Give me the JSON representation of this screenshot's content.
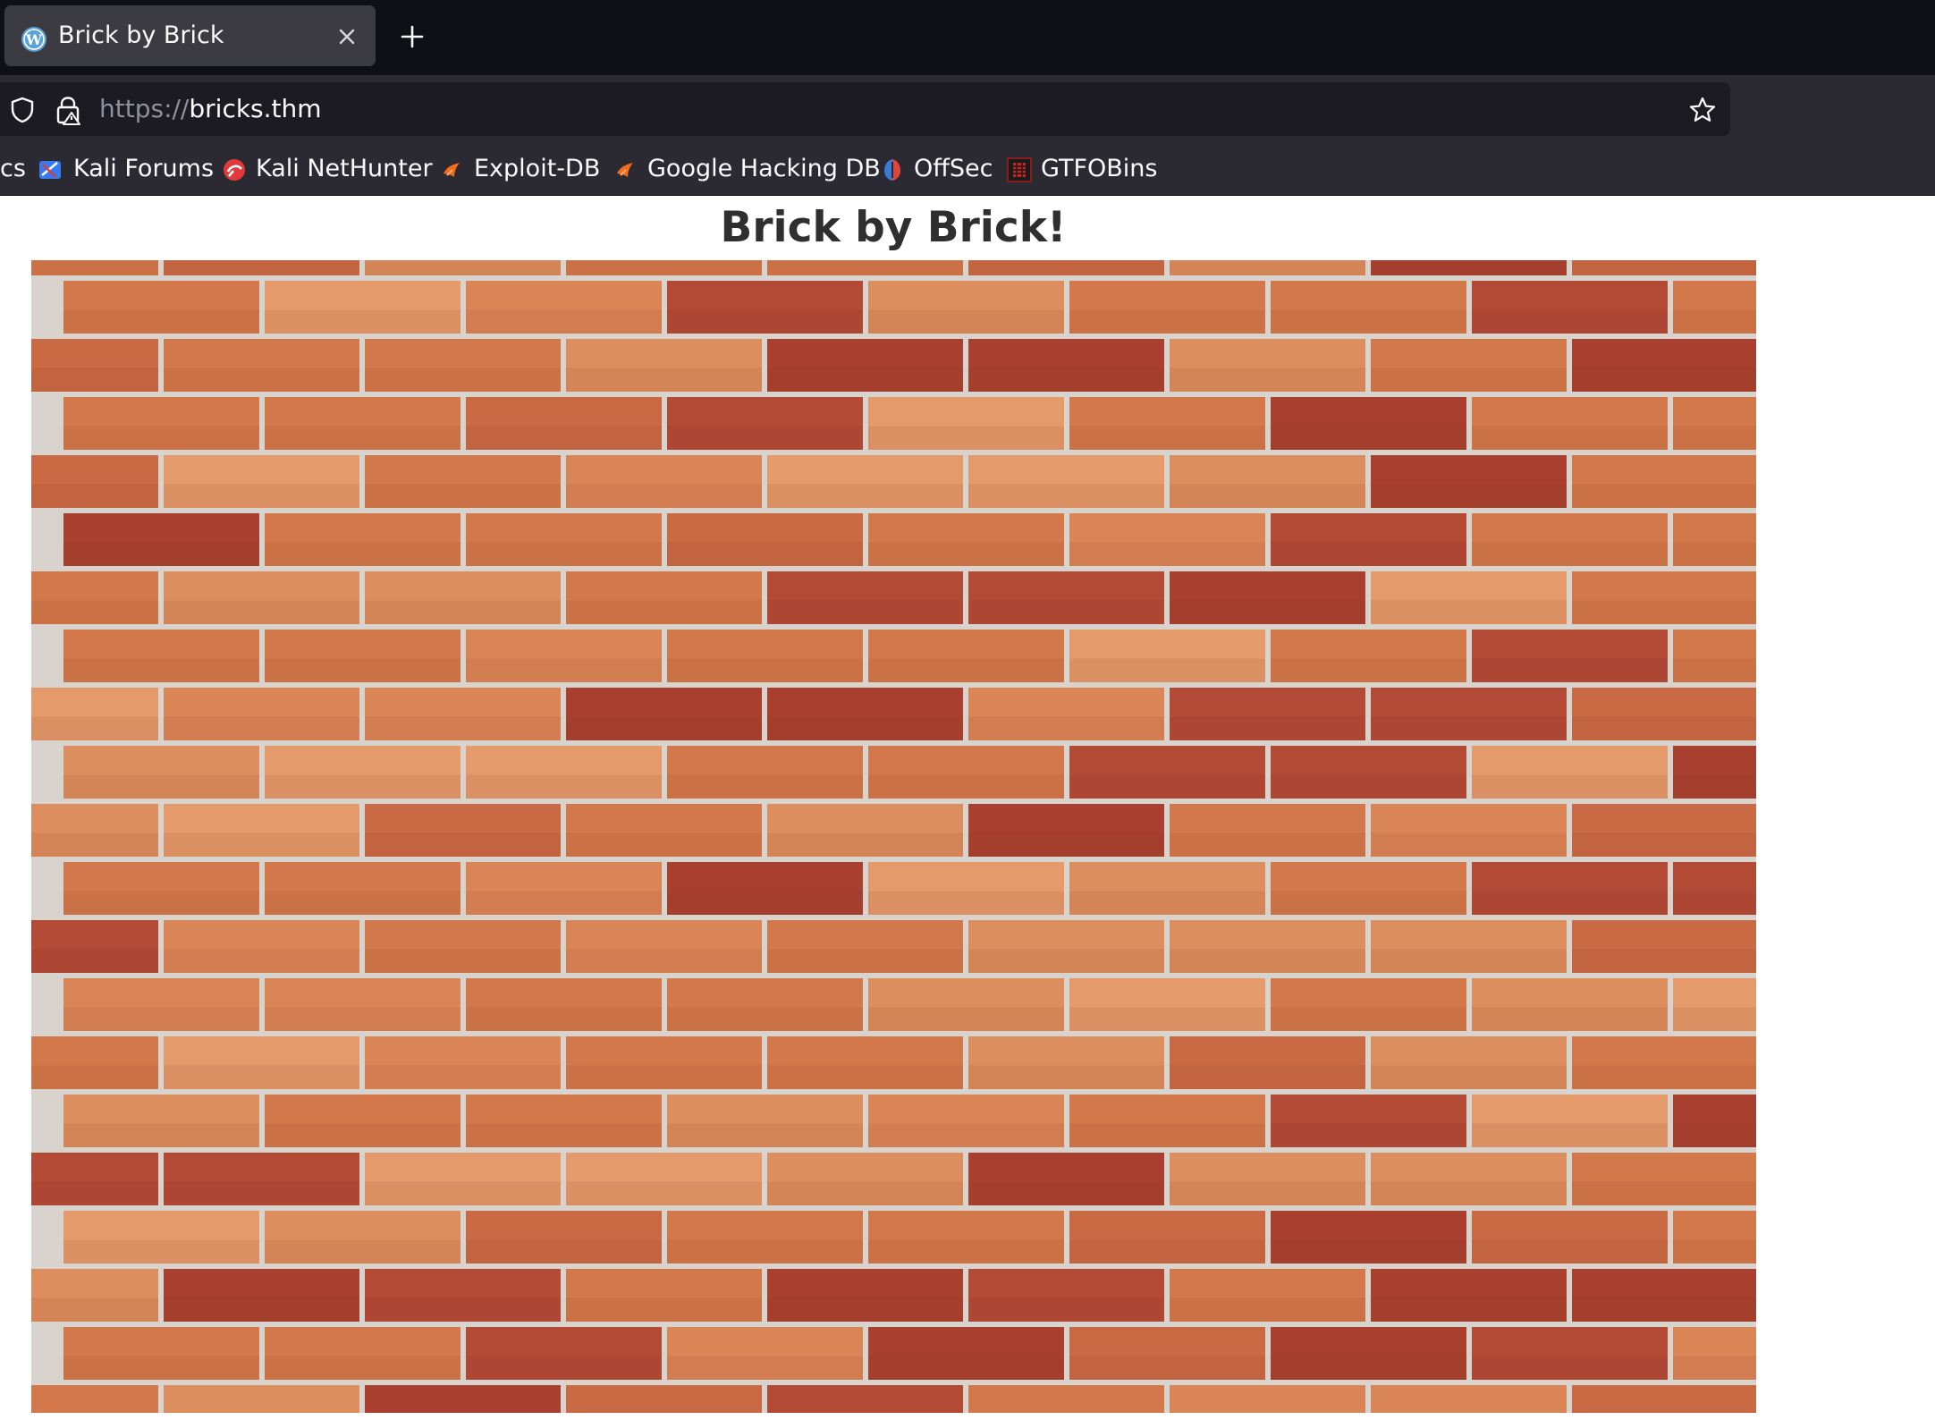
{
  "browser": {
    "tab": {
      "title": "Brick by Brick",
      "favicon": "wordpress-icon"
    },
    "new_tab_icon": "plus-icon",
    "url": {
      "scheme": "https://",
      "host": "bricks.thm"
    },
    "bookmarks": [
      {
        "label": "cs",
        "icon": ""
      },
      {
        "label": "Kali Forums",
        "icon": "kali-forums-icon"
      },
      {
        "label": "Kali NetHunter",
        "icon": "kali-nethunter-icon"
      },
      {
        "label": "Exploit-DB",
        "icon": "exploit-db-icon"
      },
      {
        "label": "Google Hacking DB",
        "icon": "exploit-db-icon"
      },
      {
        "label": "OffSec",
        "icon": "offsec-icon"
      },
      {
        "label": "GTFOBins",
        "icon": "gtfobins-icon"
      }
    ]
  },
  "page": {
    "heading": "Brick by Brick!",
    "image": "brick-wall-image"
  },
  "colors": {
    "tabstrip_bg": "#0f1015",
    "toolbar_bg": "#2b2a33",
    "urlbar_bg": "#1c1b22",
    "mortar": "#d8d3cd",
    "brick_light": "#dd8e5e",
    "brick_mid": "#d2784a",
    "brick_dark": "#b24a36"
  }
}
